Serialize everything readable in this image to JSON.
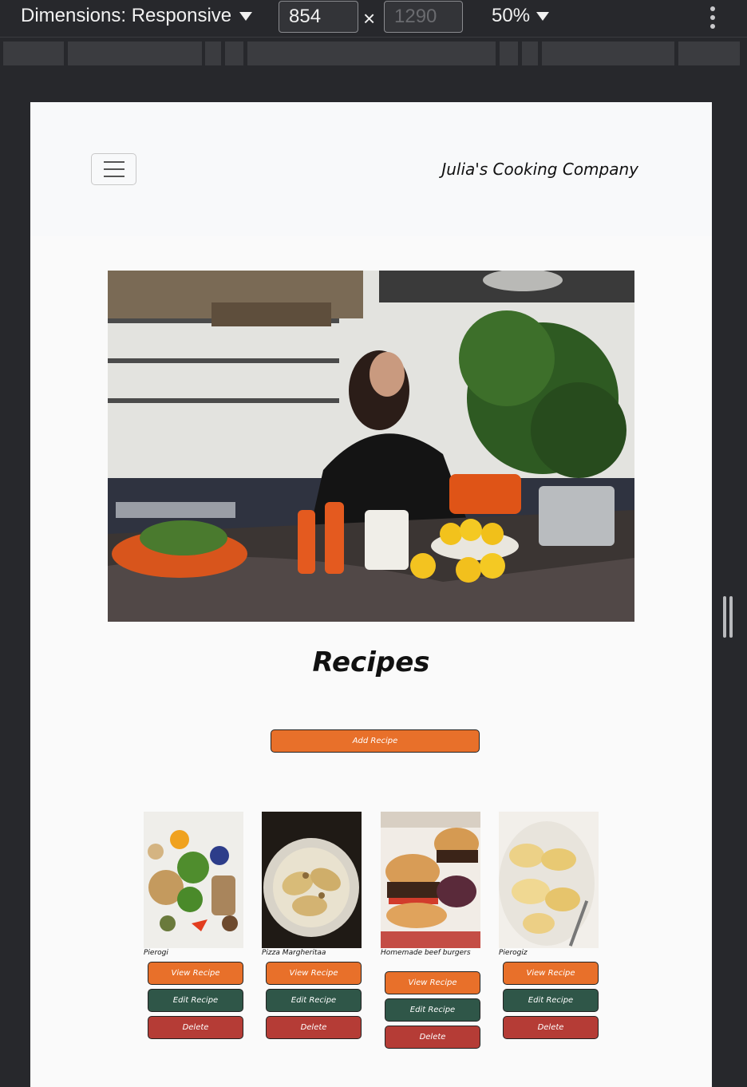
{
  "devtools": {
    "dimensions_label": "Dimensions: Responsive",
    "width_value": "854",
    "height_value": "1290",
    "times": "×",
    "zoom": "50%"
  },
  "nav": {
    "brand": "Julia's Cooking Company",
    "menu_icon": "hamburger-menu-icon"
  },
  "page": {
    "title": "Recipes",
    "add_button": "Add Recipe"
  },
  "recipes": [
    {
      "name": "Pierogi",
      "view": "View Recipe",
      "edit": "Edit Recipe",
      "delete": "Delete"
    },
    {
      "name": "Pizza Margheritaa",
      "view": "View Recipe",
      "edit": "Edit Recipe",
      "delete": "Delete"
    },
    {
      "name": "Homemade beef burgers",
      "view": "View Recipe",
      "edit": "Edit Recipe",
      "delete": "Delete"
    },
    {
      "name": "Pierogiz",
      "view": "View Recipe",
      "edit": "Edit Recipe",
      "delete": "Delete"
    }
  ],
  "colors": {
    "orange": "#e8702a",
    "green": "#2f5648",
    "red": "#b53c36"
  }
}
